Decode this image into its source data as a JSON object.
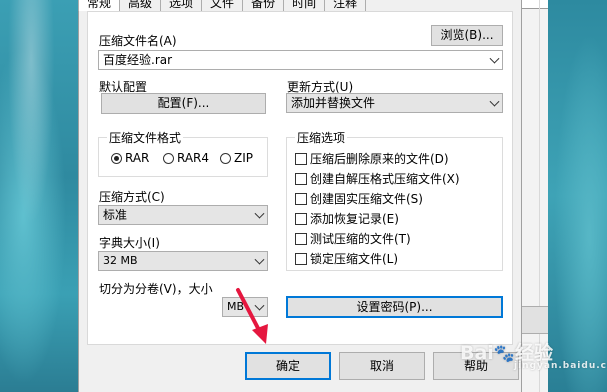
{
  "tabs": [
    "常规",
    "高级",
    "选项",
    "文件",
    "备份",
    "时间",
    "注释"
  ],
  "archive_name": {
    "label": "压缩文件名(A)",
    "value": "百度经验.rar",
    "browse_button": "浏览(B)..."
  },
  "default_profile": {
    "label": "默认配置",
    "button": "配置(F)..."
  },
  "update_mode": {
    "label": "更新方式(U)",
    "value": "添加并替换文件"
  },
  "archive_format": {
    "title": "压缩文件格式",
    "options": [
      "RAR",
      "RAR4",
      "ZIP"
    ],
    "selected": "RAR"
  },
  "compression_method": {
    "label": "压缩方式(C)",
    "value": "标准"
  },
  "dictionary_size": {
    "label": "字典大小(I)",
    "value": "32 MB"
  },
  "split_volumes": {
    "label": "切分为分卷(V)，大小",
    "unit": "MB"
  },
  "archive_options": {
    "title": "压缩选项",
    "items": [
      {
        "label": "压缩后删除原来的文件(D)",
        "checked": false
      },
      {
        "label": "创建自解压格式压缩文件(X)",
        "checked": false
      },
      {
        "label": "创建固实压缩文件(S)",
        "checked": false
      },
      {
        "label": "添加恢复记录(E)",
        "checked": false
      },
      {
        "label": "测试压缩的文件(T)",
        "checked": false
      },
      {
        "label": "锁定压缩文件(L)",
        "checked": false
      }
    ]
  },
  "set_password_button": "设置密码(P)...",
  "footer": {
    "ok": "确定",
    "cancel": "取消",
    "help": "帮助"
  },
  "watermark": {
    "text": "Bai",
    "text2": "经验",
    "sub": "jingyan.baidu.com"
  },
  "colors": {
    "focus_border": "#0078d7",
    "annotation_arrow": "#e5173f"
  }
}
